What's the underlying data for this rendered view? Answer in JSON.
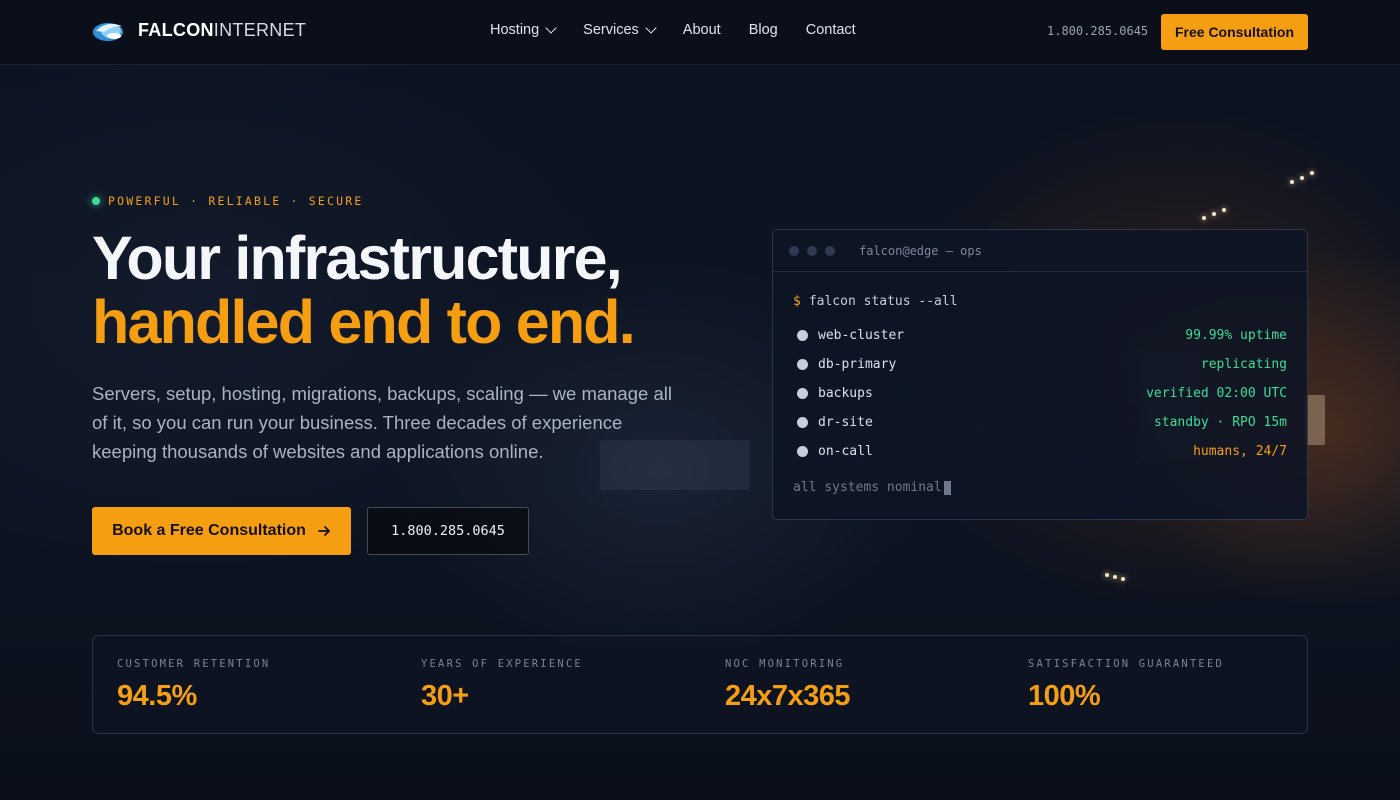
{
  "brand": {
    "name_bold": "FALCON",
    "name_light": "INTERNET",
    "logo_icon": "cloud-wing-icon"
  },
  "nav": {
    "items": [
      {
        "label": "Hosting",
        "has_dropdown": true
      },
      {
        "label": "Services",
        "has_dropdown": true
      },
      {
        "label": "About",
        "has_dropdown": false
      },
      {
        "label": "Blog",
        "has_dropdown": false
      },
      {
        "label": "Contact",
        "has_dropdown": false
      }
    ],
    "phone": "1.800.285.0645",
    "cta_label": "Free Consultation"
  },
  "hero": {
    "eyebrow": "POWERFUL · RELIABLE · SECURE",
    "headline_line1": "Your infrastructure,",
    "headline_line2": "handled end to end.",
    "lede": "Servers, setup, hosting, migrations, backups, scaling — we manage all of it, so you can run your business. Three decades of experience keeping thousands of websites and applications online.",
    "primary_cta": "Book a Free Consultation",
    "primary_cta_icon": "arrow-right-icon",
    "secondary_cta": "1.800.285.0645"
  },
  "terminal": {
    "title": "falcon@edge — ops",
    "command": "falcon status --all",
    "rows": [
      {
        "name": "web-cluster",
        "value": "99.99% uptime"
      },
      {
        "name": "db-primary",
        "value": "replicating"
      },
      {
        "name": "backups",
        "value": "verified 02:00 UTC"
      },
      {
        "name": "dr-site",
        "value": "standby · RPO 15m"
      },
      {
        "name": "on-call",
        "value": "humans, 24/7"
      }
    ],
    "footer": "all systems nominal"
  },
  "stats": [
    {
      "label": "CUSTOMER RETENTION",
      "value": "94.5%"
    },
    {
      "label": "YEARS OF EXPERIENCE",
      "value": "30+"
    },
    {
      "label": "NOC MONITORING",
      "value": "24x7x365"
    },
    {
      "label": "SATISFACTION GUARANTEED",
      "value": "100%"
    }
  ],
  "colors": {
    "accent": "#f59e12",
    "success": "#3ddc97",
    "background": "#0b111d"
  }
}
